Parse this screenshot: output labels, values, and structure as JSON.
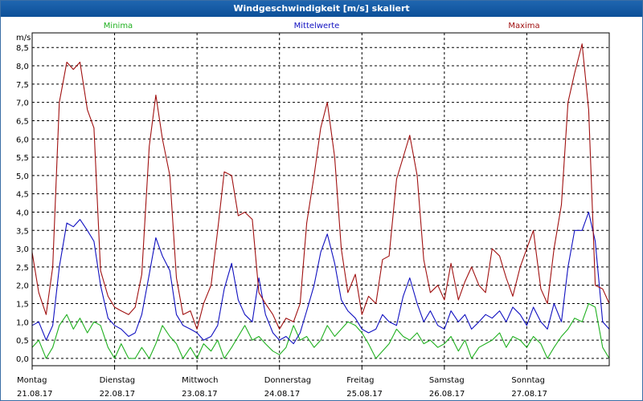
{
  "window": {
    "title": "Windgeschwindigkeit [m/s] skaliert"
  },
  "chart_data": {
    "type": "line",
    "ylabel": "m/s",
    "ylim": [
      -0.2,
      8.9
    ],
    "xlim": [
      0,
      7
    ],
    "y_ticks": [
      "0,0",
      "0,5",
      "1,0",
      "1,5",
      "2,0",
      "2,5",
      "3,0",
      "3,5",
      "4,0",
      "4,5",
      "5,0",
      "5,5",
      "6,0",
      "6,5",
      "7,0",
      "7,5",
      "8,0",
      "8,5"
    ],
    "y_tick_values": [
      0,
      0.5,
      1,
      1.5,
      2,
      2.5,
      3,
      3.5,
      4,
      4.5,
      5,
      5.5,
      6,
      6.5,
      7,
      7.5,
      8,
      8.5
    ],
    "x_ticks": [
      {
        "day": "Montag",
        "date": "21.08.17"
      },
      {
        "day": "Dienstag",
        "date": "22.08.17"
      },
      {
        "day": "Mittwoch",
        "date": "23.08.17"
      },
      {
        "day": "Donnerstag",
        "date": "24.08.17"
      },
      {
        "day": "Freitag",
        "date": "25.08.17"
      },
      {
        "day": "Samstag",
        "date": "26.08.17"
      },
      {
        "day": "Sonntag",
        "date": "27.08.17"
      }
    ],
    "grid": true,
    "legend_position": "top",
    "series": [
      {
        "name": "Minima",
        "color": "#20b020",
        "x": [
          0,
          0.08,
          0.17,
          0.25,
          0.33,
          0.42,
          0.5,
          0.58,
          0.67,
          0.75,
          0.83,
          0.92,
          1.0,
          1.08,
          1.17,
          1.25,
          1.33,
          1.42,
          1.5,
          1.58,
          1.67,
          1.75,
          1.83,
          1.92,
          2.0,
          2.08,
          2.17,
          2.25,
          2.33,
          2.42,
          2.5,
          2.58,
          2.67,
          2.75,
          2.83,
          2.92,
          3.0,
          3.08,
          3.17,
          3.25,
          3.33,
          3.42,
          3.5,
          3.58,
          3.67,
          3.75,
          3.83,
          3.92,
          4.0,
          4.08,
          4.17,
          4.25,
          4.33,
          4.42,
          4.5,
          4.58,
          4.67,
          4.75,
          4.83,
          4.92,
          5.0,
          5.08,
          5.17,
          5.25,
          5.33,
          5.42,
          5.5,
          5.58,
          5.67,
          5.75,
          5.83,
          5.92,
          6.0,
          6.08,
          6.17,
          6.25,
          6.33,
          6.42,
          6.5,
          6.58,
          6.67,
          6.75,
          6.83,
          6.92,
          7.0
        ],
        "values": [
          0.3,
          0.5,
          0,
          0.3,
          0.9,
          1.2,
          0.8,
          1.1,
          0.7,
          1.0,
          0.9,
          0.3,
          0,
          0.4,
          0,
          0,
          0.3,
          0,
          0.4,
          0.9,
          0.6,
          0.4,
          0,
          0.3,
          0,
          0.4,
          0.2,
          0.5,
          0,
          0.3,
          0.6,
          0.9,
          0.5,
          0.6,
          0.4,
          0.2,
          0.1,
          0.3,
          0.9,
          0.5,
          0.6,
          0.3,
          0.5,
          0.9,
          0.6,
          0.8,
          1.0,
          0.9,
          0.7,
          0.4,
          0,
          0.2,
          0.4,
          0.8,
          0.6,
          0.5,
          0.7,
          0.4,
          0.5,
          0.3,
          0.4,
          0.6,
          0.2,
          0.5,
          0,
          0.3,
          0.4,
          0.5,
          0.7,
          0.3,
          0.6,
          0.5,
          0.3,
          0.6,
          0.4,
          0,
          0.3,
          0.6,
          0.8,
          1.1,
          1.0,
          1.5,
          1.4,
          0.3,
          0
        ]
      },
      {
        "name": "Mittelwerte",
        "color": "#1010c0",
        "x": [
          0,
          0.08,
          0.17,
          0.25,
          0.33,
          0.42,
          0.5,
          0.58,
          0.67,
          0.75,
          0.83,
          0.92,
          1.0,
          1.08,
          1.17,
          1.25,
          1.33,
          1.42,
          1.5,
          1.58,
          1.67,
          1.75,
          1.83,
          1.92,
          2.0,
          2.08,
          2.17,
          2.25,
          2.33,
          2.42,
          2.5,
          2.58,
          2.67,
          2.75,
          2.83,
          2.92,
          3.0,
          3.08,
          3.17,
          3.25,
          3.33,
          3.42,
          3.5,
          3.58,
          3.67,
          3.75,
          3.83,
          3.92,
          4.0,
          4.08,
          4.17,
          4.25,
          4.33,
          4.42,
          4.5,
          4.58,
          4.67,
          4.75,
          4.83,
          4.92,
          5.0,
          5.08,
          5.17,
          5.25,
          5.33,
          5.42,
          5.5,
          5.58,
          5.67,
          5.75,
          5.83,
          5.92,
          6.0,
          6.08,
          6.17,
          6.25,
          6.33,
          6.42,
          6.5,
          6.58,
          6.67,
          6.75,
          6.83,
          6.92,
          7.0
        ],
        "values": [
          0.9,
          1.0,
          0.5,
          0.9,
          2.5,
          3.7,
          3.6,
          3.8,
          3.5,
          3.2,
          2.0,
          1.1,
          0.9,
          0.8,
          0.6,
          0.7,
          1.2,
          2.3,
          3.3,
          2.8,
          2.4,
          1.2,
          0.9,
          0.8,
          0.7,
          0.5,
          0.6,
          0.9,
          1.9,
          2.6,
          1.6,
          1.2,
          1.0,
          2.2,
          1.2,
          0.7,
          0.5,
          0.6,
          0.4,
          0.7,
          1.3,
          2.0,
          2.9,
          3.4,
          2.6,
          1.6,
          1.3,
          1.1,
          0.8,
          0.7,
          0.8,
          1.2,
          1.0,
          0.9,
          1.7,
          2.2,
          1.5,
          1.0,
          1.3,
          0.9,
          0.8,
          1.3,
          1.0,
          1.2,
          0.8,
          1.0,
          1.2,
          1.1,
          1.3,
          1.0,
          1.4,
          1.2,
          0.9,
          1.4,
          1.0,
          0.8,
          1.5,
          1.0,
          2.5,
          3.5,
          3.5,
          4.0,
          3.2,
          1.0,
          0.8
        ]
      },
      {
        "name": "Maxima",
        "color": "#a01010",
        "x": [
          0,
          0.08,
          0.17,
          0.25,
          0.33,
          0.42,
          0.5,
          0.58,
          0.67,
          0.75,
          0.83,
          0.92,
          1.0,
          1.08,
          1.17,
          1.25,
          1.33,
          1.42,
          1.5,
          1.58,
          1.67,
          1.75,
          1.83,
          1.92,
          2.0,
          2.08,
          2.17,
          2.25,
          2.33,
          2.42,
          2.5,
          2.58,
          2.67,
          2.75,
          2.83,
          2.92,
          3.0,
          3.08,
          3.17,
          3.25,
          3.33,
          3.42,
          3.5,
          3.58,
          3.67,
          3.75,
          3.83,
          3.92,
          4.0,
          4.08,
          4.17,
          4.25,
          4.33,
          4.42,
          4.5,
          4.58,
          4.67,
          4.75,
          4.83,
          4.92,
          5.0,
          5.08,
          5.17,
          5.25,
          5.33,
          5.42,
          5.5,
          5.58,
          5.67,
          5.75,
          5.83,
          5.92,
          6.0,
          6.08,
          6.17,
          6.25,
          6.33,
          6.42,
          6.5,
          6.58,
          6.67,
          6.75,
          6.83,
          6.92,
          7.0
        ],
        "values": [
          2.9,
          1.8,
          1.2,
          2.5,
          7.0,
          8.1,
          7.9,
          8.1,
          6.8,
          6.3,
          2.4,
          1.7,
          1.4,
          1.3,
          1.2,
          1.4,
          2.3,
          5.8,
          7.2,
          6.0,
          5.0,
          2.2,
          1.2,
          1.3,
          0.8,
          1.5,
          2.0,
          3.5,
          5.1,
          5.0,
          3.9,
          4.0,
          3.8,
          1.8,
          1.5,
          1.2,
          0.8,
          1.1,
          1.0,
          1.5,
          3.7,
          5.0,
          6.3,
          7.0,
          5.5,
          3.0,
          1.8,
          2.3,
          1.2,
          1.7,
          1.5,
          2.7,
          2.8,
          4.9,
          5.5,
          6.1,
          5.0,
          2.7,
          1.8,
          2.0,
          1.6,
          2.6,
          1.6,
          2.1,
          2.5,
          2.0,
          1.8,
          3.0,
          2.8,
          2.2,
          1.7,
          2.5,
          3.0,
          3.5,
          1.9,
          1.5,
          3.0,
          4.2,
          7.0,
          7.8,
          8.6,
          6.8,
          2.0,
          1.9,
          1.5
        ]
      }
    ]
  }
}
